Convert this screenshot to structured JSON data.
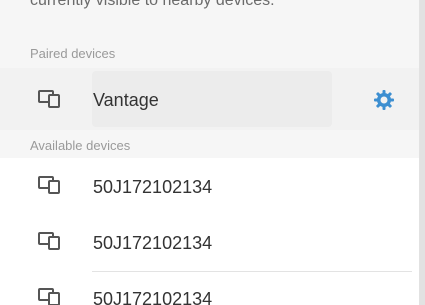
{
  "top_text": "currently visible to nearby devices.",
  "paired_section": {
    "header": "Paired devices",
    "devices": [
      {
        "name": "Vantage",
        "icon": "devices-icon",
        "settings_icon": "gear-icon"
      }
    ]
  },
  "available_section": {
    "header": "Available devices",
    "devices": [
      {
        "name": "50J172102134",
        "icon": "devices-icon"
      },
      {
        "name": "50J172102134",
        "icon": "devices-icon"
      },
      {
        "name": "50J172102134",
        "icon": "devices-icon"
      }
    ]
  },
  "colors": {
    "accent": "#3d8fd1"
  }
}
